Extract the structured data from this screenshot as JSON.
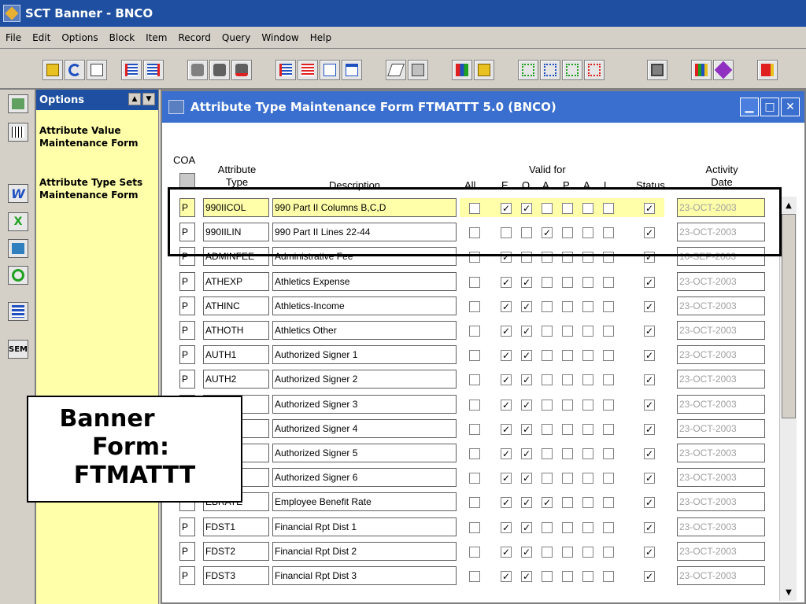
{
  "window_title": "SCT Banner - BNCO",
  "menu": [
    "File",
    "Edit",
    "Options",
    "Block",
    "Item",
    "Record",
    "Query",
    "Window",
    "Help"
  ],
  "options_panel": {
    "title": "Options",
    "items": [
      "Attribute Value Maintenance Form",
      "Attribute Type Sets Maintenance Form"
    ]
  },
  "strip_labels": [
    "SEM"
  ],
  "form": {
    "title": "Attribute Type Maintenance Form   FTMATTT  5.0  (BNCO)",
    "headers": {
      "coa": "COA",
      "attribute_type": "Attribute Type",
      "description": "Description",
      "all": "All",
      "valid_for": "Valid for",
      "valid_cols": [
        "E",
        "O",
        "A",
        "P",
        "A",
        "L"
      ],
      "status": "Status",
      "activity_date": "Activity Date"
    },
    "rows": [
      {
        "coa": "P",
        "type": "990IICOL",
        "desc": "990 Part II Columns B,C,D",
        "all": false,
        "valid": [
          true,
          true,
          false,
          false,
          false,
          false
        ],
        "status": true,
        "date": "23-OCT-2003"
      },
      {
        "coa": "P",
        "type": "990IILIN",
        "desc": "990 Part II Lines 22-44",
        "all": false,
        "valid": [
          false,
          false,
          true,
          false,
          false,
          false
        ],
        "status": true,
        "date": "23-OCT-2003"
      },
      {
        "coa": "P",
        "type": "ADMINFEE",
        "desc": "Administrative Fee",
        "all": false,
        "valid": [
          true,
          false,
          false,
          false,
          false,
          false
        ],
        "status": true,
        "date": "10-SEP-2003"
      },
      {
        "coa": "P",
        "type": "ATHEXP",
        "desc": "Athletics Expense",
        "all": false,
        "valid": [
          true,
          true,
          false,
          false,
          false,
          false
        ],
        "status": true,
        "date": "23-OCT-2003"
      },
      {
        "coa": "P",
        "type": "ATHINC",
        "desc": "Athletics-Income",
        "all": false,
        "valid": [
          true,
          true,
          false,
          false,
          false,
          false
        ],
        "status": true,
        "date": "23-OCT-2003"
      },
      {
        "coa": "P",
        "type": "ATHOTH",
        "desc": "Athletics Other",
        "all": false,
        "valid": [
          true,
          true,
          false,
          false,
          false,
          false
        ],
        "status": true,
        "date": "23-OCT-2003"
      },
      {
        "coa": "P",
        "type": "AUTH1",
        "desc": "Authorized Signer 1",
        "all": false,
        "valid": [
          true,
          true,
          false,
          false,
          false,
          false
        ],
        "status": true,
        "date": "23-OCT-2003"
      },
      {
        "coa": "P",
        "type": "AUTH2",
        "desc": "Authorized Signer 2",
        "all": false,
        "valid": [
          true,
          true,
          false,
          false,
          false,
          false
        ],
        "status": true,
        "date": "23-OCT-2003"
      },
      {
        "coa": "",
        "type": "",
        "desc": "Authorized Signer 3",
        "all": false,
        "valid": [
          true,
          true,
          false,
          false,
          false,
          false
        ],
        "status": true,
        "date": "23-OCT-2003"
      },
      {
        "coa": "",
        "type": "",
        "desc": "Authorized Signer 4",
        "all": false,
        "valid": [
          true,
          true,
          false,
          false,
          false,
          false
        ],
        "status": true,
        "date": "23-OCT-2003"
      },
      {
        "coa": "",
        "type": "",
        "desc": "Authorized Signer 5",
        "all": false,
        "valid": [
          true,
          true,
          false,
          false,
          false,
          false
        ],
        "status": true,
        "date": "23-OCT-2003"
      },
      {
        "coa": "",
        "type": "",
        "desc": "Authorized Signer 6",
        "all": false,
        "valid": [
          true,
          true,
          false,
          false,
          false,
          false
        ],
        "status": true,
        "date": "23-OCT-2003"
      },
      {
        "coa": "",
        "type": "EBRATE",
        "desc": "Employee Benefit Rate",
        "all": false,
        "valid": [
          true,
          true,
          true,
          false,
          false,
          false
        ],
        "status": true,
        "date": "23-OCT-2003"
      },
      {
        "coa": "P",
        "type": "FDST1",
        "desc": "Financial Rpt Dist 1",
        "all": false,
        "valid": [
          true,
          true,
          false,
          false,
          false,
          false
        ],
        "status": true,
        "date": "23-OCT-2003"
      },
      {
        "coa": "P",
        "type": "FDST2",
        "desc": "Financial Rpt Dist 2",
        "all": false,
        "valid": [
          true,
          true,
          false,
          false,
          false,
          false
        ],
        "status": true,
        "date": "23-OCT-2003"
      },
      {
        "coa": "P",
        "type": "FDST3",
        "desc": "Financial Rpt Dist 3",
        "all": false,
        "valid": [
          true,
          true,
          false,
          false,
          false,
          false
        ],
        "status": true,
        "date": "23-OCT-2003"
      }
    ]
  },
  "overlay_text": [
    "Banner",
    "Form:",
    "FTMATTT"
  ],
  "colors": {
    "title_bar": "#1f4fa0",
    "form_title": "#3a6fcf",
    "options_bg": "#ffffaa",
    "date_text": "#a0a0a0"
  }
}
